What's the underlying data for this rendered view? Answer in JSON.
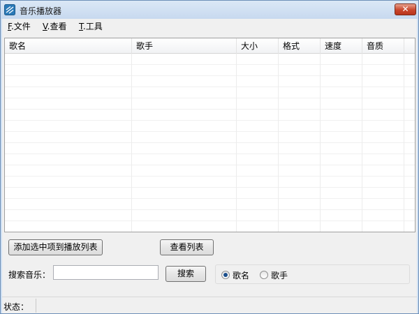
{
  "window": {
    "title": "音乐播放器",
    "close_label": "✕"
  },
  "menu": {
    "file": {
      "mnemonic": "F",
      "rest": ".文件"
    },
    "view": {
      "mnemonic": "V",
      "rest": ".查看"
    },
    "tools": {
      "mnemonic": "T",
      "rest": ".工具"
    }
  },
  "list": {
    "columns": [
      "歌名",
      "歌手",
      "大小",
      "格式",
      "速度",
      "音质"
    ],
    "rows": []
  },
  "buttons": {
    "add_selected": "添加选中项到播放列表",
    "view_list": "查看列表",
    "search": "搜索"
  },
  "search": {
    "label": "搜索音乐：",
    "value": "",
    "placeholder": ""
  },
  "search_mode": {
    "options": [
      "歌名",
      "歌手"
    ],
    "selected": "歌名"
  },
  "status": {
    "label": "状态：",
    "text": ""
  },
  "colors": {
    "title_bar": "#c7d9ef",
    "close_button": "#c9462c",
    "client_bg": "#f0f0f0",
    "radio_selected": "#1b4f8c"
  },
  "icons": {
    "app": "music-player-icon",
    "close": "close-icon"
  }
}
